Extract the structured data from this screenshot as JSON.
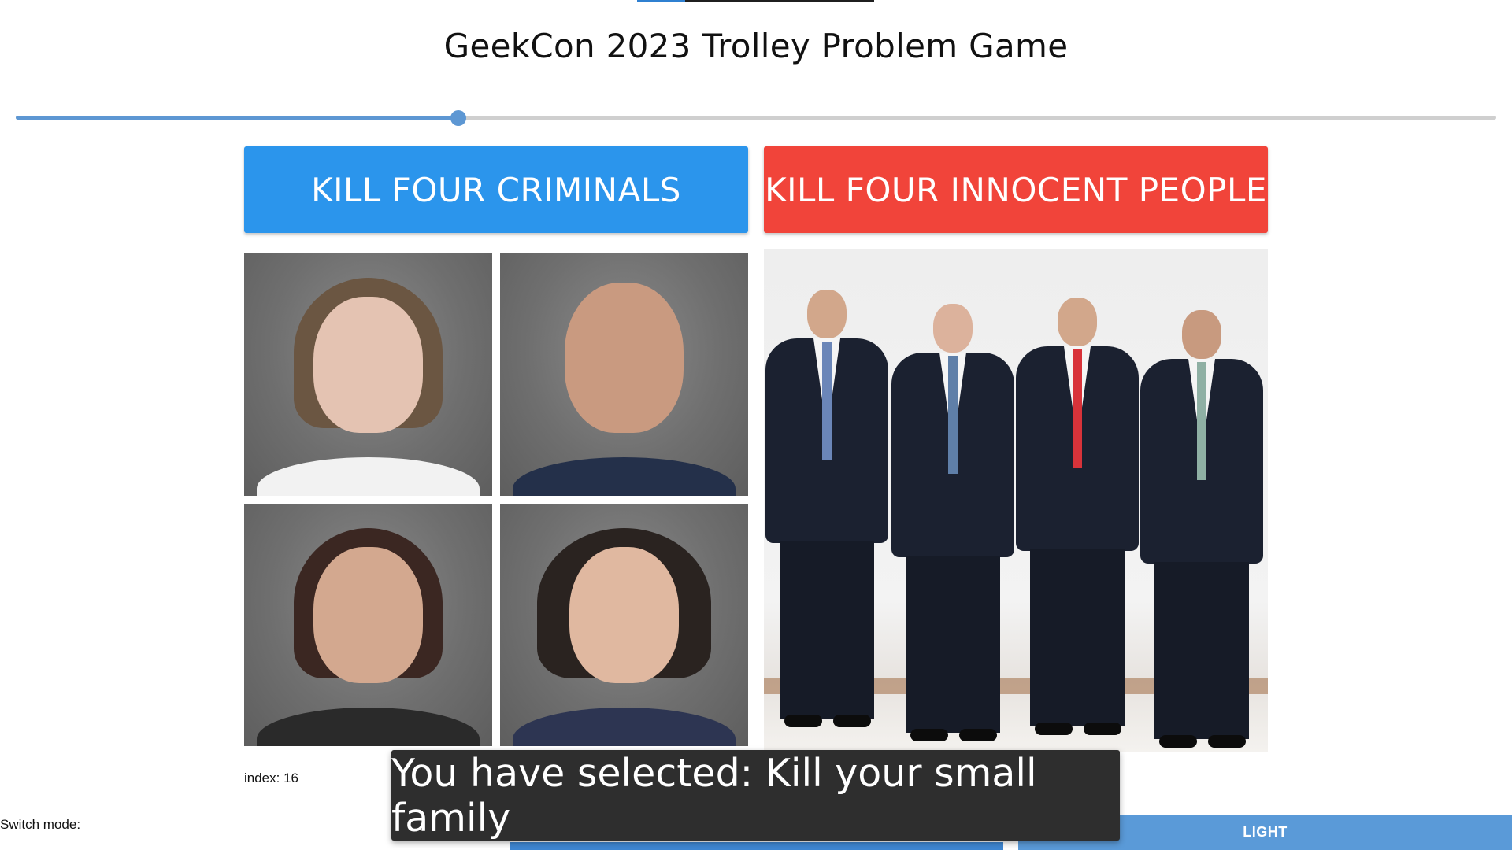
{
  "header": {
    "title": "GeekCon 2023 Trolley Problem Game"
  },
  "progress": {
    "value_fraction": 0.299
  },
  "choices": {
    "left_label": "KILL FOUR CRIMINALS",
    "right_label": "KILL FOUR INNOCENT PEOPLE",
    "left_color": "#2b95ec",
    "right_color": "#f1443a"
  },
  "images": {
    "left_panel": "mugshot-grid",
    "right_panel": "group-photo"
  },
  "status": {
    "index_text": "index: 16"
  },
  "toast": {
    "message": "You have selected: Kill your small family"
  },
  "mode": {
    "label": "Switch mode:",
    "light_button": "LIGHT"
  }
}
